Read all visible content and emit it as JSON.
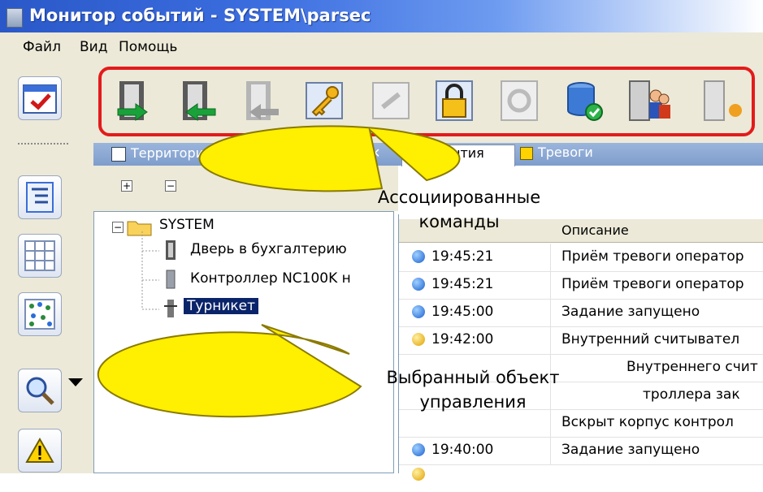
{
  "window": {
    "title": "Монитор событий - SYSTEM\\parsec"
  },
  "menu": {
    "items": [
      "Файл",
      "Вид",
      "Помощь"
    ]
  },
  "toolbar": {
    "buttons": [
      "door-open-in-icon",
      "door-open-out-icon",
      "door-pass-disabled-icon",
      "key-icon",
      "unlock-disabled-icon",
      "padlock-icon",
      "lock-disabled-icon",
      "database-check-icon",
      "door-users-icon",
      "door-extra-icon"
    ]
  },
  "territory_panel": {
    "header": "Территории - Турникет",
    "close": "✕",
    "expand_all": "+",
    "collapse_all": "−",
    "tree": {
      "root": "SYSTEM",
      "root_toggle": "−",
      "children": [
        {
          "label": "Дверь в бухгалтерию",
          "icon": "door-icon"
        },
        {
          "label": "Контроллер NC100K н",
          "icon": "controller-icon"
        },
        {
          "label": "Турникет",
          "icon": "turnstile-icon",
          "selected": true
        }
      ]
    }
  },
  "events_tabs": {
    "tabs": [
      {
        "label": "События",
        "active": true
      },
      {
        "label": "Тревоги",
        "active": false
      }
    ]
  },
  "events_grid": {
    "columns": {
      "description": "Описание"
    },
    "rows": [
      {
        "time": "19:45:21",
        "description": "Приём тревоги оператор",
        "status": "blue"
      },
      {
        "time": "19:45:21",
        "description": "Приём тревоги оператор",
        "status": "blue"
      },
      {
        "time": "19:45:00",
        "description": "Задание запущено",
        "status": "blue"
      },
      {
        "time": "19:42:00",
        "description": "Внутренний считывател",
        "status": "yellow"
      },
      {
        "time": "",
        "description": "Внутреннего счит",
        "status": "none"
      },
      {
        "time": "",
        "description": "троллера зак",
        "status": "none"
      },
      {
        "time": "",
        "description": "Вскрыт корпус контрол",
        "status": "none"
      },
      {
        "time": "19:40:00",
        "description": "Задание запущено",
        "status": "blue"
      }
    ]
  },
  "callouts": {
    "associated_commands": "Ассоциированные команды",
    "selected_object": "Выбранный объект управления"
  },
  "colors": {
    "highlight": "#e31b1b",
    "callout_fill": "#ffef00",
    "title_bar": "#2a58c8",
    "selection": "#0a246a"
  }
}
